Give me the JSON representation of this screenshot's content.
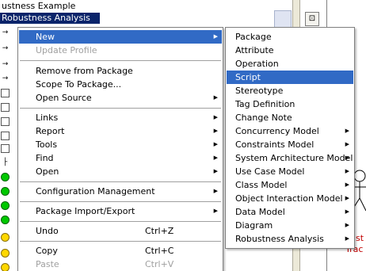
{
  "tree": {
    "title": "ustness Example",
    "selected_item": "Robustness Analysis"
  },
  "context_menu": {
    "items": [
      {
        "label": "New",
        "shortcut": "",
        "submenu": true,
        "highlighted": true,
        "disabled": false
      },
      {
        "label": "Update Profile",
        "shortcut": "",
        "submenu": false,
        "highlighted": false,
        "disabled": true
      },
      {
        "label": "Remove from Package",
        "shortcut": "",
        "submenu": false,
        "highlighted": false,
        "disabled": false
      },
      {
        "label": "Scope To Package...",
        "shortcut": "",
        "submenu": false,
        "highlighted": false,
        "disabled": false
      },
      {
        "label": "Open Source",
        "shortcut": "",
        "submenu": true,
        "highlighted": false,
        "disabled": false
      },
      {
        "label": "Links",
        "shortcut": "",
        "submenu": true,
        "highlighted": false,
        "disabled": false
      },
      {
        "label": "Report",
        "shortcut": "",
        "submenu": true,
        "highlighted": false,
        "disabled": false
      },
      {
        "label": "Tools",
        "shortcut": "",
        "submenu": true,
        "highlighted": false,
        "disabled": false
      },
      {
        "label": "Find",
        "shortcut": "",
        "submenu": true,
        "highlighted": false,
        "disabled": false
      },
      {
        "label": "Open",
        "shortcut": "",
        "submenu": true,
        "highlighted": false,
        "disabled": false
      },
      {
        "label": "Configuration Management",
        "shortcut": "",
        "submenu": true,
        "highlighted": false,
        "disabled": false
      },
      {
        "label": "Package Import/Export",
        "shortcut": "",
        "submenu": true,
        "highlighted": false,
        "disabled": false
      },
      {
        "label": "Undo",
        "shortcut": "Ctrl+Z",
        "submenu": false,
        "highlighted": false,
        "disabled": false
      },
      {
        "label": "Copy",
        "shortcut": "Ctrl+C",
        "submenu": false,
        "highlighted": false,
        "disabled": false
      },
      {
        "label": "Paste",
        "shortcut": "Ctrl+V",
        "submenu": false,
        "highlighted": false,
        "disabled": true
      }
    ]
  },
  "new_submenu": {
    "items": [
      {
        "label": "Package",
        "submenu": false,
        "highlighted": false
      },
      {
        "label": "Attribute",
        "submenu": false,
        "highlighted": false
      },
      {
        "label": "Operation",
        "submenu": false,
        "highlighted": false
      },
      {
        "label": "Script",
        "submenu": false,
        "highlighted": true
      },
      {
        "label": "Stereotype",
        "submenu": false,
        "highlighted": false
      },
      {
        "label": "Tag Definition",
        "submenu": false,
        "highlighted": false
      },
      {
        "label": "Change Note",
        "submenu": false,
        "highlighted": false
      },
      {
        "label": "Concurrency Model",
        "submenu": true,
        "highlighted": false
      },
      {
        "label": "Constraints Model",
        "submenu": true,
        "highlighted": false
      },
      {
        "label": "System Architecture Model",
        "submenu": true,
        "highlighted": false
      },
      {
        "label": "Use Case Model",
        "submenu": true,
        "highlighted": false
      },
      {
        "label": "Class Model",
        "submenu": true,
        "highlighted": false
      },
      {
        "label": "Object Interaction Model",
        "submenu": true,
        "highlighted": false
      },
      {
        "label": "Data Model",
        "submenu": true,
        "highlighted": false
      },
      {
        "label": "Diagram",
        "submenu": true,
        "highlighted": false
      },
      {
        "label": "Robustness Analysis",
        "submenu": true,
        "highlighted": false
      }
    ]
  },
  "right_panel": {
    "red_text_1": "ist",
    "red_text_2": "Trac"
  },
  "colors": {
    "highlight": "#316ac5",
    "selection": "#0a246a",
    "disabled_text": "#a0a0a0",
    "accent_red": "#c00000"
  },
  "icons": {
    "submenu_arrow": "triangle-right-icon",
    "tree_arrow": "arrow-icon",
    "panel_button": "view-icon",
    "actor": "stick-figure-icon"
  }
}
